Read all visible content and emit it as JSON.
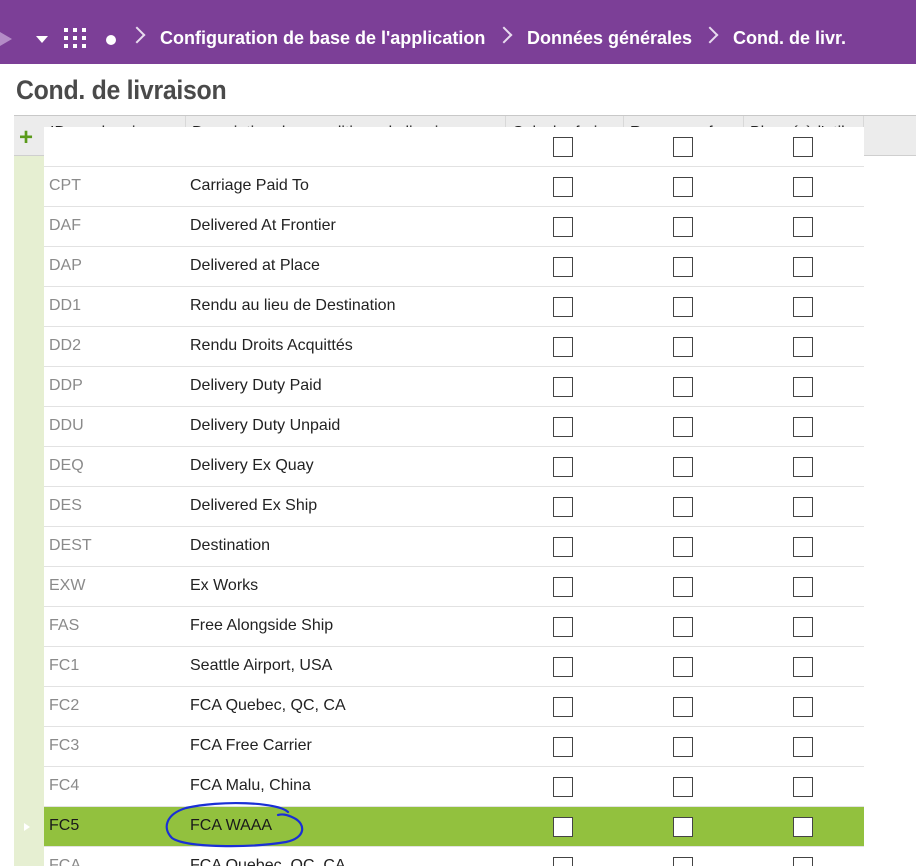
{
  "breadcrumb": {
    "items": [
      {
        "label": "Configuration de base de l'application"
      },
      {
        "label": "Données générales"
      },
      {
        "label": "Cond. de livr."
      }
    ]
  },
  "page": {
    "title": "Cond. de livraison"
  },
  "grid": {
    "add_icon": "+",
    "columns": [
      {
        "label": "ID cond. paiem."
      },
      {
        "label": "Description des conditions de livraison"
      },
      {
        "label": "Calculer frais"
      },
      {
        "label": "Recouvrer fr..."
      },
      {
        "label": "Bloqué à l'util..."
      }
    ],
    "rows": [
      {
        "id": "CPT",
        "description": "Carriage Paid To"
      },
      {
        "id": "DAF",
        "description": "Delivered At Frontier"
      },
      {
        "id": "DAP",
        "description": "Delivered at Place"
      },
      {
        "id": "DD1",
        "description": "Rendu au lieu de Destination"
      },
      {
        "id": "DD2",
        "description": "Rendu Droits Acquittés"
      },
      {
        "id": "DDP",
        "description": "Delivery Duty Paid"
      },
      {
        "id": "DDU",
        "description": "Delivery Duty Unpaid"
      },
      {
        "id": "DEQ",
        "description": "Delivery Ex Quay"
      },
      {
        "id": "DES",
        "description": "Delivered Ex Ship"
      },
      {
        "id": "DEST",
        "description": "Destination"
      },
      {
        "id": "EXW",
        "description": "Ex Works"
      },
      {
        "id": "FAS",
        "description": "Free Alongside Ship"
      },
      {
        "id": "FC1",
        "description": "Seattle Airport, USA"
      },
      {
        "id": "FC2",
        "description": "FCA Quebec, QC, CA"
      },
      {
        "id": "FC3",
        "description": "FCA Free Carrier"
      },
      {
        "id": "FC4",
        "description": "FCA Malu, China"
      },
      {
        "id": "FC5",
        "description": "FCA WAAA",
        "selected": true
      },
      {
        "id": "FCA",
        "description": "FCA Quebec, QC, CA"
      }
    ]
  },
  "colors": {
    "topbar": "#7c3f97",
    "selected_row": "#92c13e",
    "annotation": "#1a2fd6"
  }
}
